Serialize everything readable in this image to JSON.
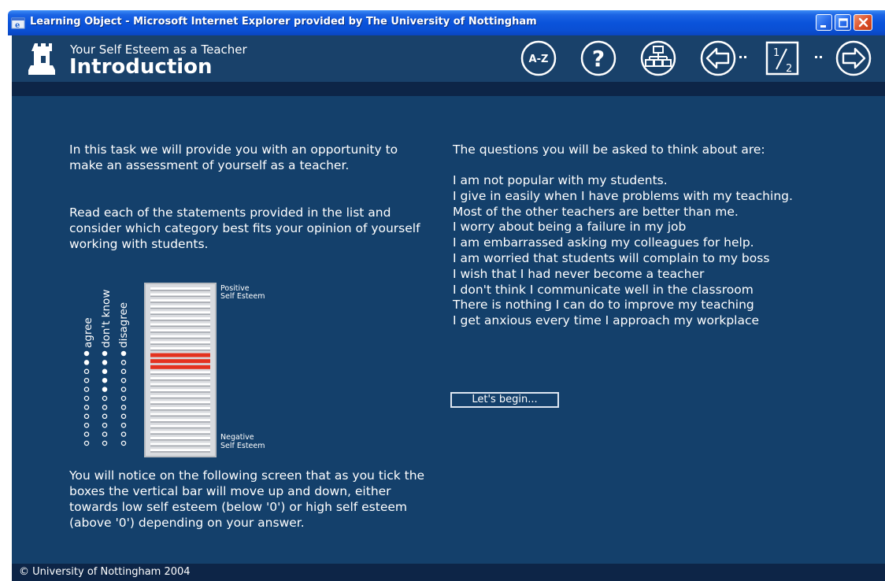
{
  "window": {
    "title": "Learning Object - Microsoft Internet Explorer provided by The University of Nottingham"
  },
  "header": {
    "subtitle": "Your Self Esteem as a Teacher",
    "title": "Introduction",
    "nav": {
      "glossary_label": "A-Z",
      "help_label": "?",
      "page_current": "1",
      "page_total": "2"
    }
  },
  "content": {
    "intro": "In this task we will provide you with an opportunity to make an assessment of yourself as a teacher.",
    "instructions": "Read each of the statements provided in the list and consider which category best fits your opinion of yourself working with students.",
    "notice": "You will notice on the following screen that as you tick the boxes the vertical bar will move up and down, either towards low self esteem (below '0') or high self esteem (above '0') depending on your answer.",
    "questions_title": "The questions you will be asked to think about are:",
    "questions": [
      "I am not popular with my students.",
      "I give in easily when I have problems with my teaching.",
      "Most of the other teachers are better than me.",
      "I worry about being a failure in my job",
      "I am embarrassed asking my colleagues for help.",
      "I am worried that students will complain to my boss",
      "I wish that I had never become a teacher",
      "I don't think I communicate well in the classroom",
      "There is nothing I can do to improve my teaching",
      "I get anxious every time I approach my workplace"
    ],
    "begin_button": "Let's begin..."
  },
  "illustration": {
    "column_labels": [
      "agree",
      "don't know",
      "disagree"
    ],
    "top_label_line1": "Positive",
    "top_label_line2": "Self Esteem",
    "bottom_label_line1": "Negative",
    "bottom_label_line2": "Self Esteem"
  },
  "footer": {
    "copyright": "© University of Nottingham 2004"
  },
  "colors": {
    "panel": "#14406b",
    "header": "#19416a",
    "stripe": "#0d2547",
    "highlight": "#e4321f"
  }
}
